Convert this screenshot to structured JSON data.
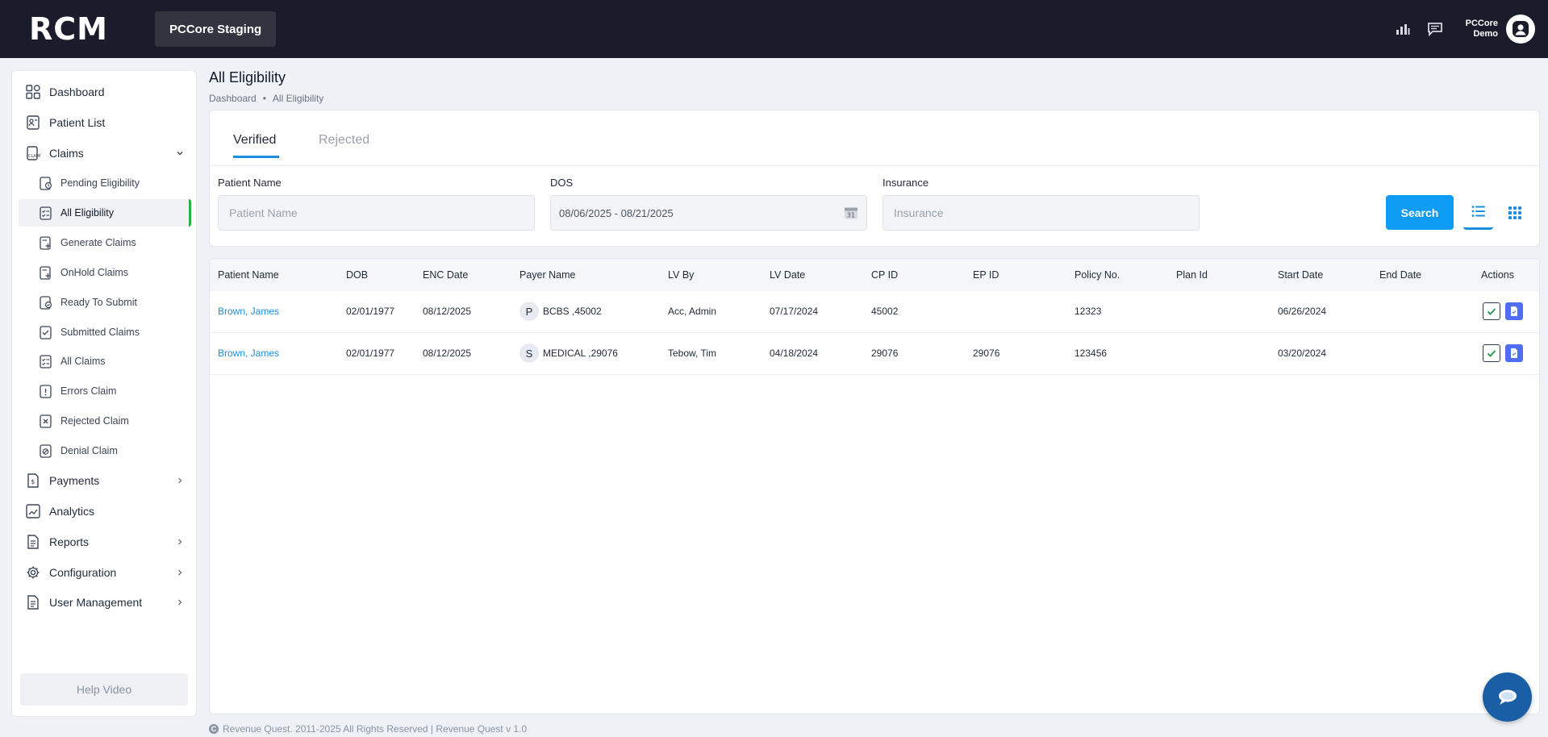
{
  "header": {
    "logo": "RCM",
    "environment": "PCCore Staging",
    "user_line1": "PCCore",
    "user_line2": "Demo"
  },
  "sidebar": {
    "items": [
      {
        "label": "Dashboard",
        "icon": "dashboard-icon"
      },
      {
        "label": "Patient List",
        "icon": "patient-list-icon"
      },
      {
        "label": "Claims",
        "icon": "claims-icon",
        "expanded": true
      },
      {
        "label": "Payments",
        "icon": "payments-icon"
      },
      {
        "label": "Analytics",
        "icon": "analytics-icon"
      },
      {
        "label": "Reports",
        "icon": "reports-icon"
      },
      {
        "label": "Configuration",
        "icon": "gear-icon"
      },
      {
        "label": "User Management",
        "icon": "user-management-icon"
      }
    ],
    "claims_sub": [
      {
        "label": "Pending Eligibility"
      },
      {
        "label": "All Eligibility",
        "active": true
      },
      {
        "label": "Generate Claims"
      },
      {
        "label": "OnHold Claims"
      },
      {
        "label": "Ready To Submit"
      },
      {
        "label": "Submitted Claims"
      },
      {
        "label": "All Claims"
      },
      {
        "label": "Errors Claim"
      },
      {
        "label": "Rejected Claim"
      },
      {
        "label": "Denial Claim"
      }
    ],
    "help_video": "Help Video"
  },
  "page": {
    "title": "All Eligibility",
    "breadcrumb": [
      "Dashboard",
      "All Eligibility"
    ]
  },
  "filters": {
    "tabs": [
      "Verified",
      "Rejected"
    ],
    "active_tab": "Verified",
    "patient_name_label": "Patient Name",
    "patient_name_placeholder": "Patient Name",
    "dos_label": "DOS",
    "dos_value": "08/06/2025 - 08/21/2025",
    "calendar_day": "31",
    "insurance_label": "Insurance",
    "insurance_placeholder": "Insurance",
    "search_label": "Search"
  },
  "table": {
    "columns": [
      "Patient Name",
      "DOB",
      "ENC Date",
      "Payer Name",
      "LV By",
      "LV Date",
      "CP ID",
      "EP ID",
      "Policy No.",
      "Plan Id",
      "Start Date",
      "End Date",
      "Actions"
    ],
    "rows": [
      {
        "patient": "Brown, James",
        "dob": "02/01/1977",
        "enc": "08/12/2025",
        "payer_initial": "P",
        "payer": "BCBS ,45002",
        "lv_by": "Acc, Admin",
        "lv_date": "07/17/2024",
        "cp_id": "45002",
        "ep_id": "",
        "policy": "12323",
        "plan_id": "",
        "start": "06/26/2024",
        "end": ""
      },
      {
        "patient": "Brown, James",
        "dob": "02/01/1977",
        "enc": "08/12/2025",
        "payer_initial": "S",
        "payer": "MEDICAL ,29076",
        "lv_by": "Tebow, Tim",
        "lv_date": "04/18/2024",
        "cp_id": "29076",
        "ep_id": "29076",
        "policy": "123456",
        "plan_id": "",
        "start": "03/20/2024",
        "end": ""
      }
    ]
  },
  "footer": {
    "text": "Revenue Quest. 2011-2025 All Rights Reserved | Revenue Quest v 1.0"
  },
  "colors": {
    "topbar": "#1b1c2b",
    "accent": "#0d9bf3",
    "active_marker": "#22b14c",
    "link": "#1a8fe0"
  }
}
